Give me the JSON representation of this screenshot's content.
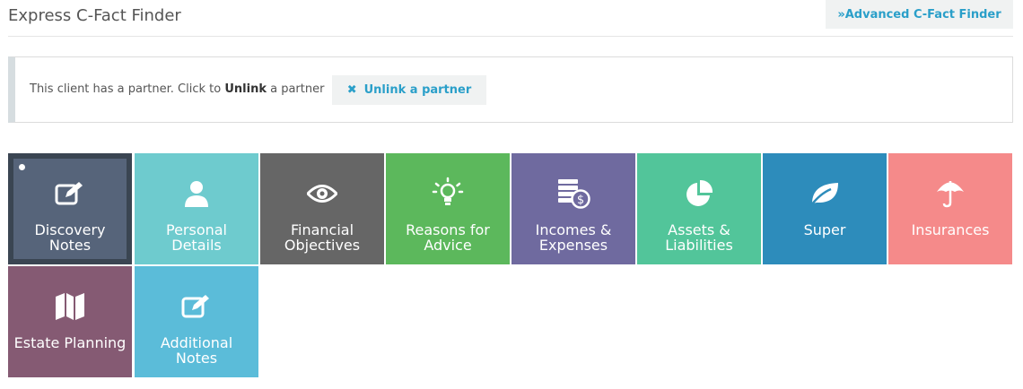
{
  "header": {
    "title": "Express C-Fact Finder",
    "advanced_button": "»Advanced C-Fact Finder"
  },
  "partner": {
    "text_before": "This client has a partner. Click to ",
    "text_bold": "Unlink",
    "text_after": " a partner",
    "unlink_label": "Unlink a partner",
    "unlink_icon": "close-icon"
  },
  "tiles": [
    {
      "line1": "Discovery",
      "line2": "Notes",
      "icon": "edit-icon",
      "color": "#56647a",
      "active": true
    },
    {
      "line1": "Personal",
      "line2": "Details",
      "icon": "user-icon",
      "color": "#6ecbce"
    },
    {
      "line1": "Financial",
      "line2": "Objectives",
      "icon": "eye-icon",
      "color": "#666666"
    },
    {
      "line1": "Reasons for",
      "line2": "Advice",
      "icon": "lightbulb-icon",
      "color": "#5cb85c"
    },
    {
      "line1": "Incomes &",
      "line2": "Expenses",
      "icon": "coins-icon",
      "color": "#6f6a9f"
    },
    {
      "line1": "Assets &",
      "line2": "Liabilities",
      "icon": "pie-chart-icon",
      "color": "#52c59a"
    },
    {
      "line1": "Super",
      "line2": "",
      "icon": "leaf-icon",
      "color": "#2d8cbb"
    },
    {
      "line1": "Insurances",
      "line2": "",
      "icon": "umbrella-icon",
      "color": "#f58a8a"
    },
    {
      "line1": "Estate Planning",
      "line2": "",
      "icon": "map-icon",
      "color": "#855a73"
    },
    {
      "line1": "Additional",
      "line2": "Notes",
      "icon": "edit-icon",
      "color": "#5bbcd9"
    }
  ]
}
